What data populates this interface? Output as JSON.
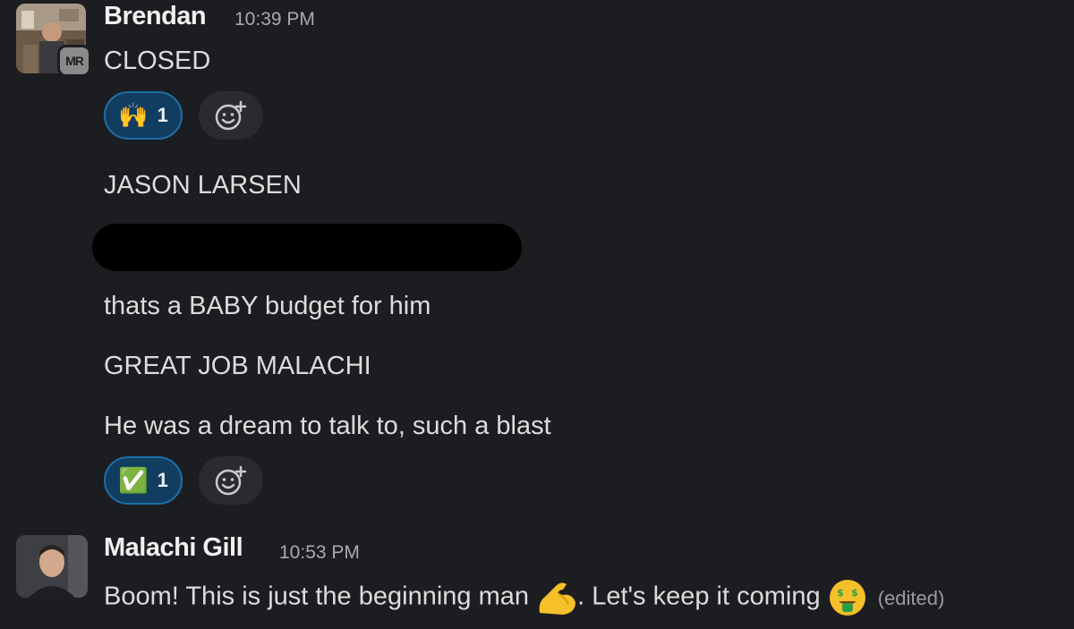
{
  "messages": {
    "brendan": {
      "sender": "Brendan",
      "time": "10:39 PM",
      "avatar_badge": "MR",
      "lines": [
        "CLOSED",
        "JASON LARSEN",
        "thats a BABY budget for him",
        "GREAT JOB MALACHI",
        "He was a dream to talk to, such a blast"
      ],
      "reactions": [
        {
          "emoji": "🙌",
          "count": "1"
        },
        {
          "emoji": "✅",
          "count": "1"
        }
      ]
    },
    "malachi": {
      "sender": "Malachi Gill",
      "time": "10:53 PM",
      "text_part1": "Boom! This is just the beginning man",
      "text_part2": ". Let's keep it coming",
      "edited": "(edited)",
      "emoji_1": "flexed-biceps",
      "emoji_2": "money-mouth-face"
    }
  },
  "colors": {
    "background": "#1c1d21",
    "reaction_bg": "#113d61",
    "reaction_border": "#1d6fa8"
  }
}
